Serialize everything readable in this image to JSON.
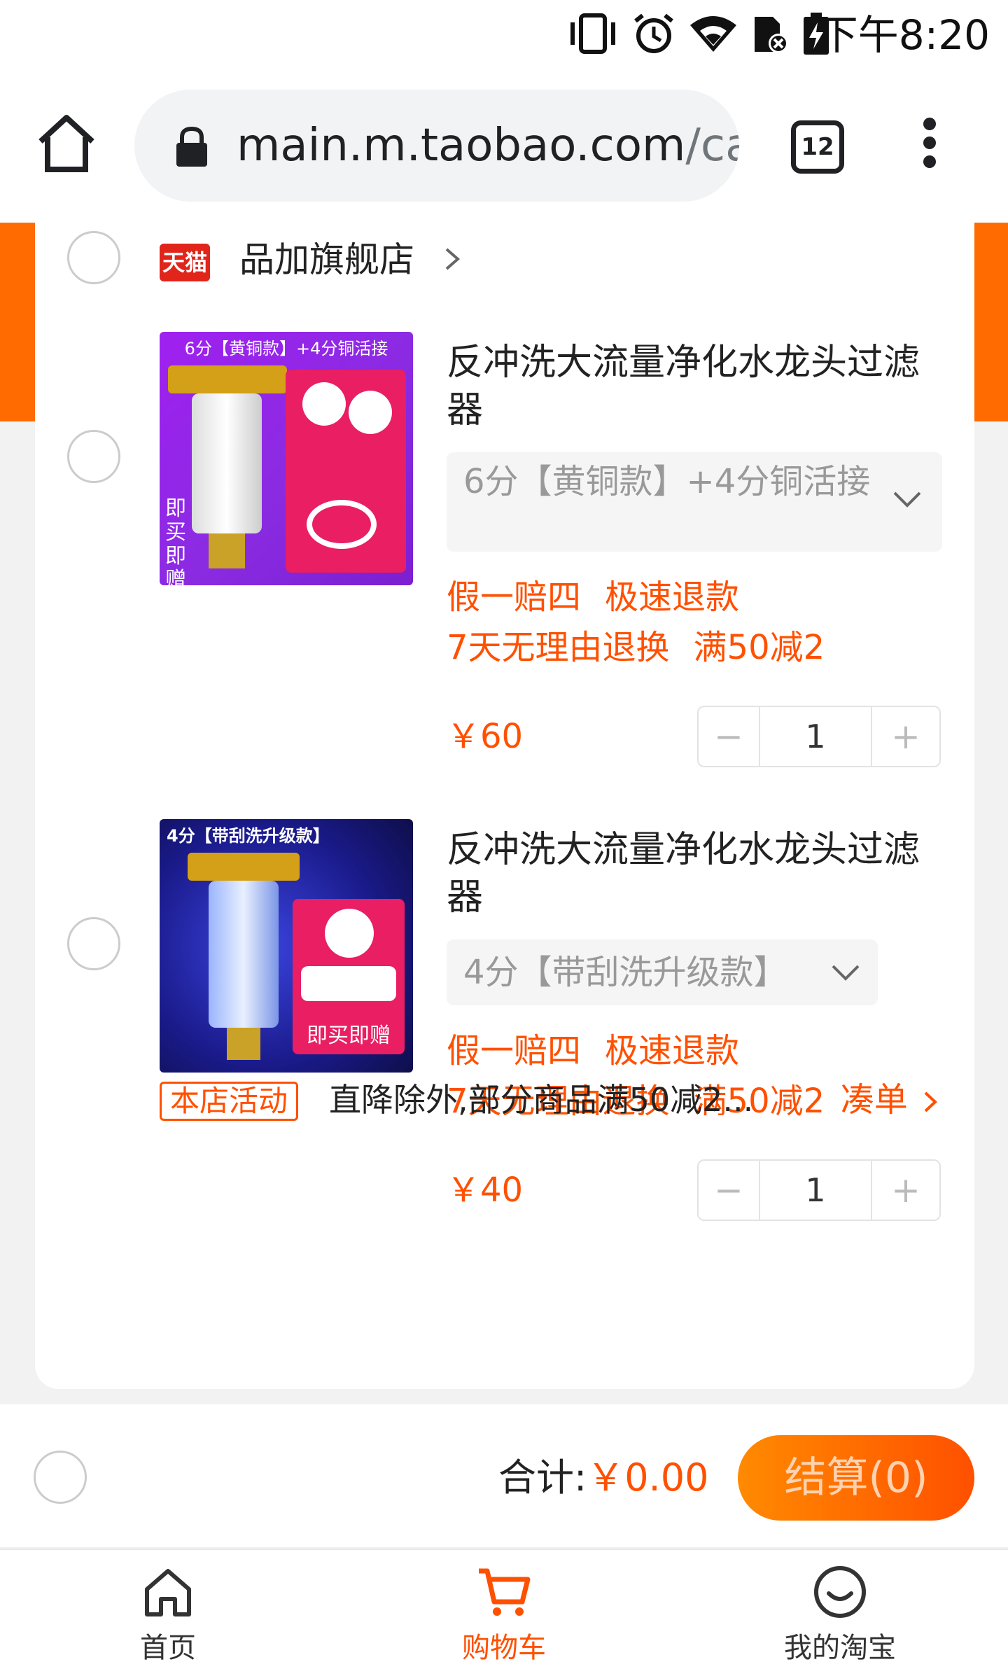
{
  "status_bar": {
    "time": "下午8:20"
  },
  "browser": {
    "url_host": "main.m.taobao.com",
    "url_path": "/car",
    "tab_count": "12"
  },
  "shop": {
    "badge": "天猫",
    "name": "品加旗舰店"
  },
  "products": [
    {
      "image_caption": "6分【黄铜款】+4分铜活接",
      "image_gift": "即买即赠",
      "title": "反冲洗大流量净化水龙头过滤器",
      "sku": "6分【黄铜款】+4分铜活接",
      "tags_line1": [
        "假一赔四",
        "极速退款"
      ],
      "tags_line2": [
        "7天无理由退换",
        "满50减2"
      ],
      "price": "￥60",
      "quantity": "1"
    },
    {
      "image_caption": "4分【带刮洗升级款】",
      "image_gift": "即买即赠",
      "title": "反冲洗大流量净化水龙头过滤器",
      "sku": "4分【带刮洗升级款】",
      "tags_line1": [
        "假一赔四",
        "极速退款"
      ],
      "tags_line2": [
        "7天无理由退换",
        "满50减2"
      ],
      "price": "￥40",
      "quantity": "1"
    }
  ],
  "promotion": {
    "badge": "本店活动",
    "text": "直降除外,部分商品满50减2...",
    "link": "凑单"
  },
  "checkout": {
    "total_label": "合计:",
    "total_amount": "￥0.00",
    "button": "结算(0)"
  },
  "bottom_nav": [
    {
      "label": "首页",
      "icon": "home-icon"
    },
    {
      "label": "购物车",
      "icon": "cart-icon",
      "active": true
    },
    {
      "label": "我的淘宝",
      "icon": "smiley-icon"
    }
  ],
  "colors": {
    "accent": "#ff5000",
    "tmall_red": "#e1251b",
    "band": "#ff6b00"
  }
}
